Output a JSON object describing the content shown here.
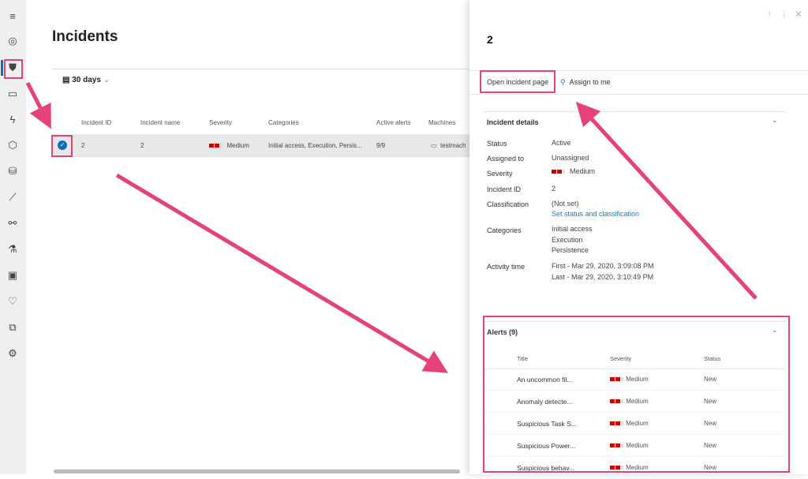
{
  "sidebar": {
    "items": [
      "hamburger-menu",
      "dashboard",
      "incidents",
      "machines",
      "alerts",
      "threat-analytics",
      "automated-investigations",
      "reports",
      "partners",
      "evaluation-lab",
      "device-inventory",
      "health",
      "configuration",
      "settings"
    ],
    "active": "incidents"
  },
  "page": {
    "title": "Incidents",
    "filter": "30 days"
  },
  "table": {
    "headers": [
      "Incident ID",
      "Incident name",
      "Severity",
      "Categories",
      "Active alerts",
      "Machines"
    ],
    "rows": [
      {
        "id": "2",
        "name": "2",
        "severity": "Medium",
        "categories": "Initial access, Execution, Persis...",
        "active_alerts": "9/9",
        "machines": "testmach"
      }
    ]
  },
  "panel": {
    "title": "2",
    "open_page": "Open incident page",
    "assign": "Assign to me",
    "details": {
      "heading": "Incident details",
      "status_label": "Status",
      "status": "Active",
      "assigned_label": "Assigned to",
      "assigned": "Unassigned",
      "severity_label": "Severity",
      "severity": "Medium",
      "id_label": "Incident ID",
      "id": "2",
      "classification_label": "Classification",
      "classification": "(Not set)",
      "classification_link": "Set status and classification",
      "categories_label": "Categories",
      "categories": [
        "Initial access",
        "Execution",
        "Persistence"
      ],
      "activity_label": "Activity time",
      "first": "First - Mar 29, 2020, 3:09:08 PM",
      "last": "Last - Mar 29, 2020, 3:10:49 PM"
    },
    "alerts": {
      "heading": "Alerts (9)",
      "headers": [
        "Title",
        "Severity",
        "Status"
      ],
      "rows": [
        {
          "title": "An uncommon fil...",
          "severity": "Medium",
          "status": "New"
        },
        {
          "title": "Anomaly detecte...",
          "severity": "Medium",
          "status": "New"
        },
        {
          "title": "Suspicious Task S...",
          "severity": "Medium",
          "status": "New"
        },
        {
          "title": "Suspicious Power...",
          "severity": "Medium",
          "status": "New"
        },
        {
          "title": "Suspicious behav...",
          "severity": "Medium",
          "status": "New"
        }
      ]
    }
  },
  "colors": {
    "accent": "#0f6cbd",
    "highlight": "#e5417a",
    "severity": "#cc0000"
  }
}
